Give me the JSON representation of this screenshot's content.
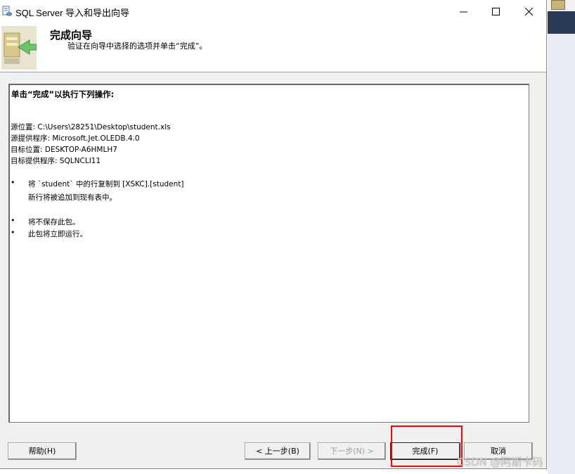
{
  "window": {
    "title": "SQL Server 导入和导出向导"
  },
  "header": {
    "title": "完成向导",
    "subtitle": "验证在向导中选择的选项并单击“完成”。"
  },
  "summary": {
    "heading": "单击“完成”以执行下列操作:",
    "source_location": "源位置: C:\\Users\\28251\\Desktop\\student.xls",
    "source_provider": "源提供程序: Microsoft.Jet.OLEDB.4.0",
    "target_location": "目标位置: DESKTOP-A6HMLH7",
    "target_provider": "目标提供程序: SQLNCLI11",
    "bullet_char": "•",
    "copy_line": "将 `student` 中的行复制到 [XSKC].[student]",
    "append_line": "新行将被追加到现有表中。",
    "not_save_line": "将不保存此包。",
    "run_now_line": "此包将立即运行。"
  },
  "buttons": {
    "help": "帮助(H)",
    "back": "< 上一步(B)",
    "next": "下一步(N) >",
    "finish": "完成(F)",
    "cancel": "取消"
  },
  "watermark": "CSDN @阿斯卡码",
  "colors": {
    "highlight": "#ff0000",
    "window_bg": "#f0f0f0"
  },
  "icons": {
    "app": "db-transfer-icon",
    "wizard": "wizard-arrow-icon"
  }
}
